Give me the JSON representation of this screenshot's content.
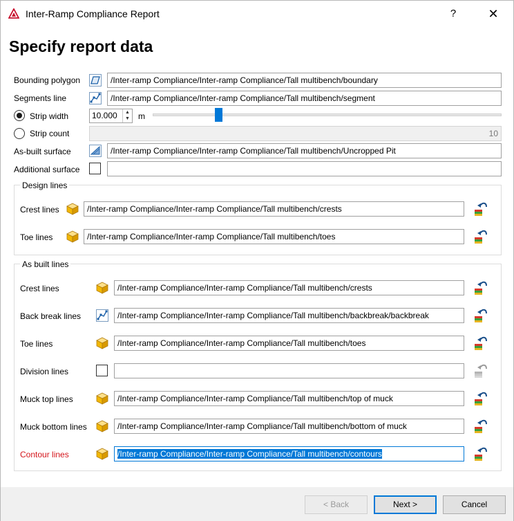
{
  "window": {
    "title": "Inter-Ramp Compliance Report",
    "help": "?",
    "close": "✕"
  },
  "heading": "Specify report data",
  "top": {
    "bounding_polygon": {
      "label": "Bounding polygon",
      "value": "/Inter-ramp Compliance/Inter-ramp Compliance/Tall multibench/boundary"
    },
    "segments_line": {
      "label": "Segments line",
      "value": "/Inter-ramp Compliance/Inter-ramp Compliance/Tall multibench/segment"
    },
    "strip_width": {
      "label": "Strip width",
      "value": "10.000",
      "unit": "m",
      "slider_fraction": 0.19
    },
    "strip_count": {
      "label": "Strip count",
      "value": "10"
    },
    "as_built_surface": {
      "label": "As-built surface",
      "value": "/Inter-ramp Compliance/Inter-ramp Compliance/Tall multibench/Uncropped Pit"
    },
    "additional_surface": {
      "label": "Additional surface",
      "value": ""
    }
  },
  "design_lines": {
    "title": "Design lines",
    "crest": {
      "label": "Crest lines",
      "value": "/Inter-ramp Compliance/Inter-ramp Compliance/Tall multibench/crests"
    },
    "toe": {
      "label": "Toe lines",
      "value": "/Inter-ramp Compliance/Inter-ramp Compliance/Tall multibench/toes"
    }
  },
  "as_built_lines": {
    "title": "As built lines",
    "crest": {
      "label": "Crest lines",
      "value": "/Inter-ramp Compliance/Inter-ramp Compliance/Tall multibench/crests"
    },
    "back_break": {
      "label": "Back break lines",
      "value": "/Inter-ramp Compliance/Inter-ramp Compliance/Tall multibench/backbreak/backbreak"
    },
    "toe": {
      "label": "Toe lines",
      "value": "/Inter-ramp Compliance/Inter-ramp Compliance/Tall multibench/toes"
    },
    "division": {
      "label": "Division lines",
      "value": ""
    },
    "muck_top": {
      "label": "Muck top lines",
      "value": "/Inter-ramp Compliance/Inter-ramp Compliance/Tall multibench/top of muck"
    },
    "muck_bottom": {
      "label": "Muck bottom lines",
      "value": "/Inter-ramp Compliance/Inter-ramp Compliance/Tall multibench/bottom of muck"
    },
    "contour": {
      "label": "Contour lines",
      "value": "/Inter-ramp Compliance/Inter-ramp Compliance/Tall multibench/contours"
    }
  },
  "buttons": {
    "back": "< Back",
    "next": "Next >",
    "cancel": "Cancel"
  },
  "colors": {
    "accent": "#0078d7",
    "error_label": "#d4141a",
    "cube": "#f5c242"
  }
}
